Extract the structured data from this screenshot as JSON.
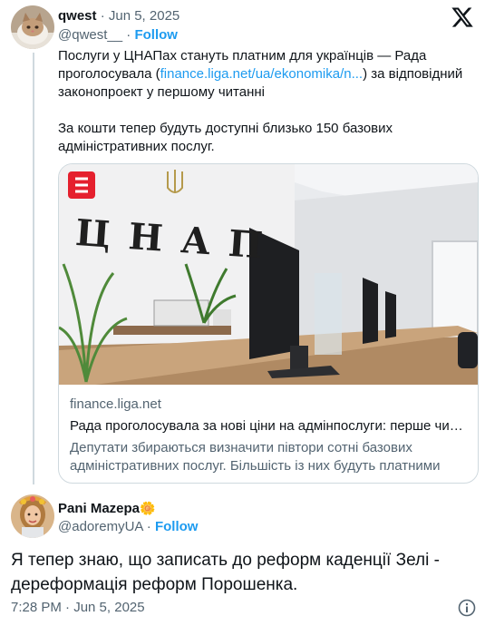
{
  "quoted_tweet": {
    "author_name": "qwest",
    "date": "· Jun 5, 2025",
    "handle": "@qwest__",
    "separator": "·",
    "follow_label": "Follow",
    "text_part1": "Послуги у ЦНАПах стануть платним для українців — Рада проголосувала (",
    "link_text": "finance.liga.net/ua/ekonomika/n...",
    "text_part2": ") за відповідний законопроект у першому читанні",
    "text_paragraph2": "За кошти тепер будуть доступні близько 150 базових адміністративних послуг.",
    "avatar_icon": "cat-photo-avatar",
    "card": {
      "wall_text": "ЦНАП",
      "domain": "finance.liga.net",
      "title": "Рада проголосувала за нові ціни на адмінпослуги: перше читання",
      "description": "Депутати збираються визначити півтори сотні базових адміністративних послуг. Більшість із них будуть платними",
      "logo_color": "#e5202e"
    }
  },
  "reply_tweet": {
    "author_name": "Pani Mazepa",
    "flower_emoji": "🌼",
    "handle": "@adoremyUA",
    "separator": "·",
    "follow_label": "Follow",
    "text": "Я тепер знаю, що записать до реформ каденції Зелі - дереформація реформ Порошенка.",
    "timestamp": "7:28 PM · Jun 5, 2025"
  },
  "colors": {
    "accent": "#1d9bf0",
    "text": "#0f1419",
    "muted": "#536471",
    "border": "#cfd9de"
  }
}
